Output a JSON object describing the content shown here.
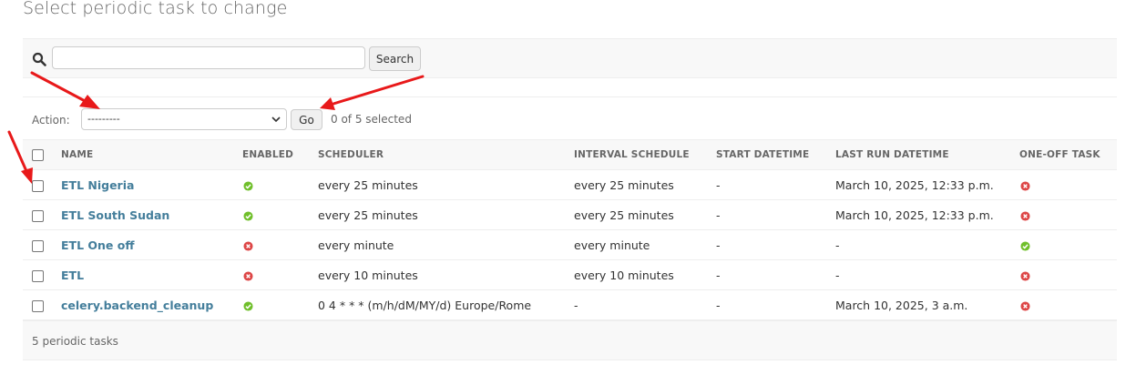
{
  "page_title": "Select periodic task to change",
  "search": {
    "value": "",
    "button_label": "Search",
    "icon": "search-icon"
  },
  "actions": {
    "label": "Action:",
    "selected_option": "---------",
    "go_label": "Go",
    "selected_count": "0 of 5 selected"
  },
  "table": {
    "headers": {
      "name": "NAME",
      "enabled": "ENABLED",
      "scheduler": "SCHEDULER",
      "interval": "INTERVAL SCHEDULE",
      "start": "START DATETIME",
      "last_run": "LAST RUN DATETIME",
      "one_off": "ONE-OFF TASK"
    },
    "rows": [
      {
        "name": "ETL Nigeria",
        "enabled": true,
        "scheduler": "every 25 minutes",
        "interval": "every 25 minutes",
        "start": "-",
        "last_run": "March 10, 2025, 12:33 p.m.",
        "one_off": false
      },
      {
        "name": "ETL South Sudan",
        "enabled": true,
        "scheduler": "every 25 minutes",
        "interval": "every 25 minutes",
        "start": "-",
        "last_run": "March 10, 2025, 12:33 p.m.",
        "one_off": false
      },
      {
        "name": "ETL One off",
        "enabled": false,
        "scheduler": "every minute",
        "interval": "every minute",
        "start": "-",
        "last_run": "-",
        "one_off": true
      },
      {
        "name": "ETL",
        "enabled": false,
        "scheduler": "every 10 minutes",
        "interval": "every 10 minutes",
        "start": "-",
        "last_run": "-",
        "one_off": false
      },
      {
        "name": "celery.backend_cleanup",
        "enabled": true,
        "scheduler": "0 4 * * * (m/h/dM/MY/d) Europe/Rome",
        "interval": "-",
        "start": "-",
        "last_run": "March 10, 2025, 3 a.m.",
        "one_off": false
      }
    ]
  },
  "footer": {
    "count_text": "5 periodic tasks"
  },
  "colors": {
    "yes": "#70bf2b",
    "no": "#dd4646",
    "link": "#447e9b",
    "arrow": "#e8191a"
  }
}
